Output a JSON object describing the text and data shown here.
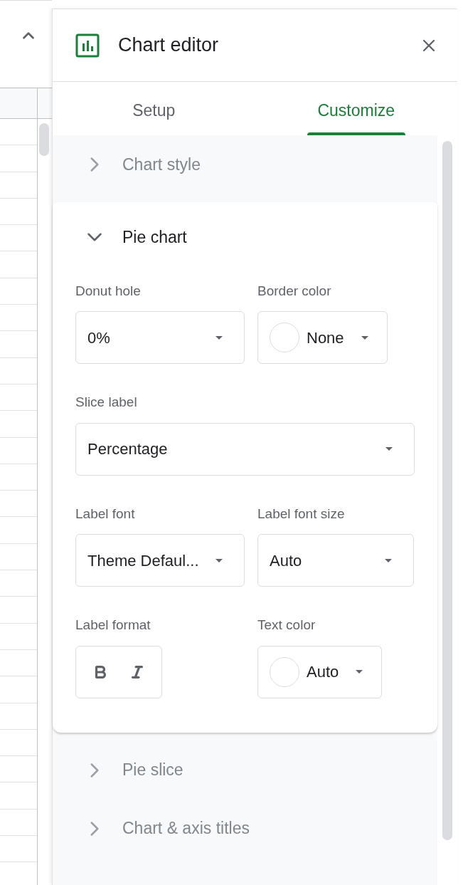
{
  "header": {
    "title": "Chart editor"
  },
  "tabs": [
    {
      "label": "Setup",
      "selected": false
    },
    {
      "label": "Customize",
      "selected": true
    }
  ],
  "sections": [
    {
      "title": "Chart style",
      "expanded": false
    },
    {
      "title": "Pie chart",
      "expanded": true,
      "rows": [
        [
          {
            "kind": "dropdown",
            "label": "Donut hole",
            "value": "0%"
          },
          {
            "kind": "color",
            "label": "Border color",
            "value": "None"
          }
        ],
        [
          {
            "kind": "dropdown",
            "label": "Slice label",
            "value": "Percentage"
          }
        ],
        [
          {
            "kind": "dropdown",
            "label": "Label font",
            "value": "Theme Defaul..."
          },
          {
            "kind": "dropdown",
            "label": "Label font size",
            "value": "Auto"
          }
        ],
        [
          {
            "kind": "format",
            "label": "Label format"
          },
          {
            "kind": "color",
            "label": "Text color",
            "value": "Auto"
          }
        ]
      ]
    },
    {
      "title": "Pie slice",
      "expanded": false
    },
    {
      "title": "Chart & axis titles",
      "expanded": false
    }
  ]
}
